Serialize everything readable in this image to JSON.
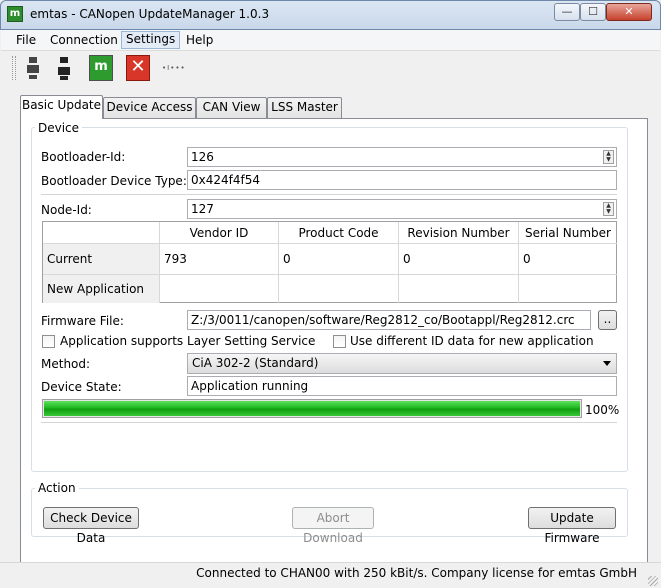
{
  "window": {
    "title": "emtas - CANopen UpdateManager 1.0.3",
    "icon": "m-logo-icon",
    "app_icon_text": "m",
    "min_glyph": "—",
    "max_glyph": "☐",
    "close_glyph": "✕"
  },
  "menu": {
    "file": "File",
    "connection": "Connection",
    "settings": "Settings",
    "help": "Help"
  },
  "toolbar": {
    "connect_icon": "plug-connect-icon",
    "disconnect_icon": "plug-disconnect-icon",
    "bootloader_icon": "m-logo-icon",
    "bootloader_text": "m",
    "stop_icon": "red-x-icon",
    "stop_text": "✕",
    "small_icon": "bus-icon",
    "small_text": "•I•••"
  },
  "tabs": [
    {
      "label": "Basic Update",
      "selected": true
    },
    {
      "label": "Device Access",
      "selected": false
    },
    {
      "label": "CAN View",
      "selected": false
    },
    {
      "label": "LSS Master",
      "selected": false
    }
  ],
  "device": {
    "group_title": "Device",
    "bootloader_id_label": "Bootloader-Id:",
    "bootloader_id_value": "126",
    "bootloader_type_label": "Bootloader Device Type:",
    "bootloader_type_value": "0x424f4f54",
    "node_id_label": "Node-Id:",
    "node_id_value": "127",
    "table": {
      "columns": [
        "Vendor ID",
        "Product Code",
        "Revision Number",
        "Serial Number"
      ],
      "rows": [
        {
          "label": "Current Application",
          "values": [
            "793",
            "0",
            "0",
            "0"
          ]
        },
        {
          "label": "New Application",
          "values": [
            "",
            "",
            "",
            ""
          ]
        }
      ]
    },
    "firmware_label": "Firmware File:",
    "firmware_value": "Z:/3/0011/canopen/software/Reg2812_co/Bootappl/Reg2812.crc",
    "browse_label": "..",
    "lss_checkbox_label": "Application supports Layer Setting Service",
    "lss_checked": false,
    "diff_id_checkbox_label": "Use different ID data for new application",
    "diff_id_checked": false,
    "method_label": "Method:",
    "method_value": "CiA 302-2 (Standard)",
    "state_label": "Device State:",
    "state_value": "Application running",
    "progress_percent": 100,
    "progress_text": "100%",
    "spin_up": "▲",
    "spin_down": "▼"
  },
  "action": {
    "group_title": "Action",
    "check_label": "Check Device Data",
    "abort_label": "Abort Download",
    "update_label": "Update Firmware"
  },
  "status": {
    "text": "Connected to CHAN00 with 250 kBit/s.  Company license for emtas GmbH"
  }
}
